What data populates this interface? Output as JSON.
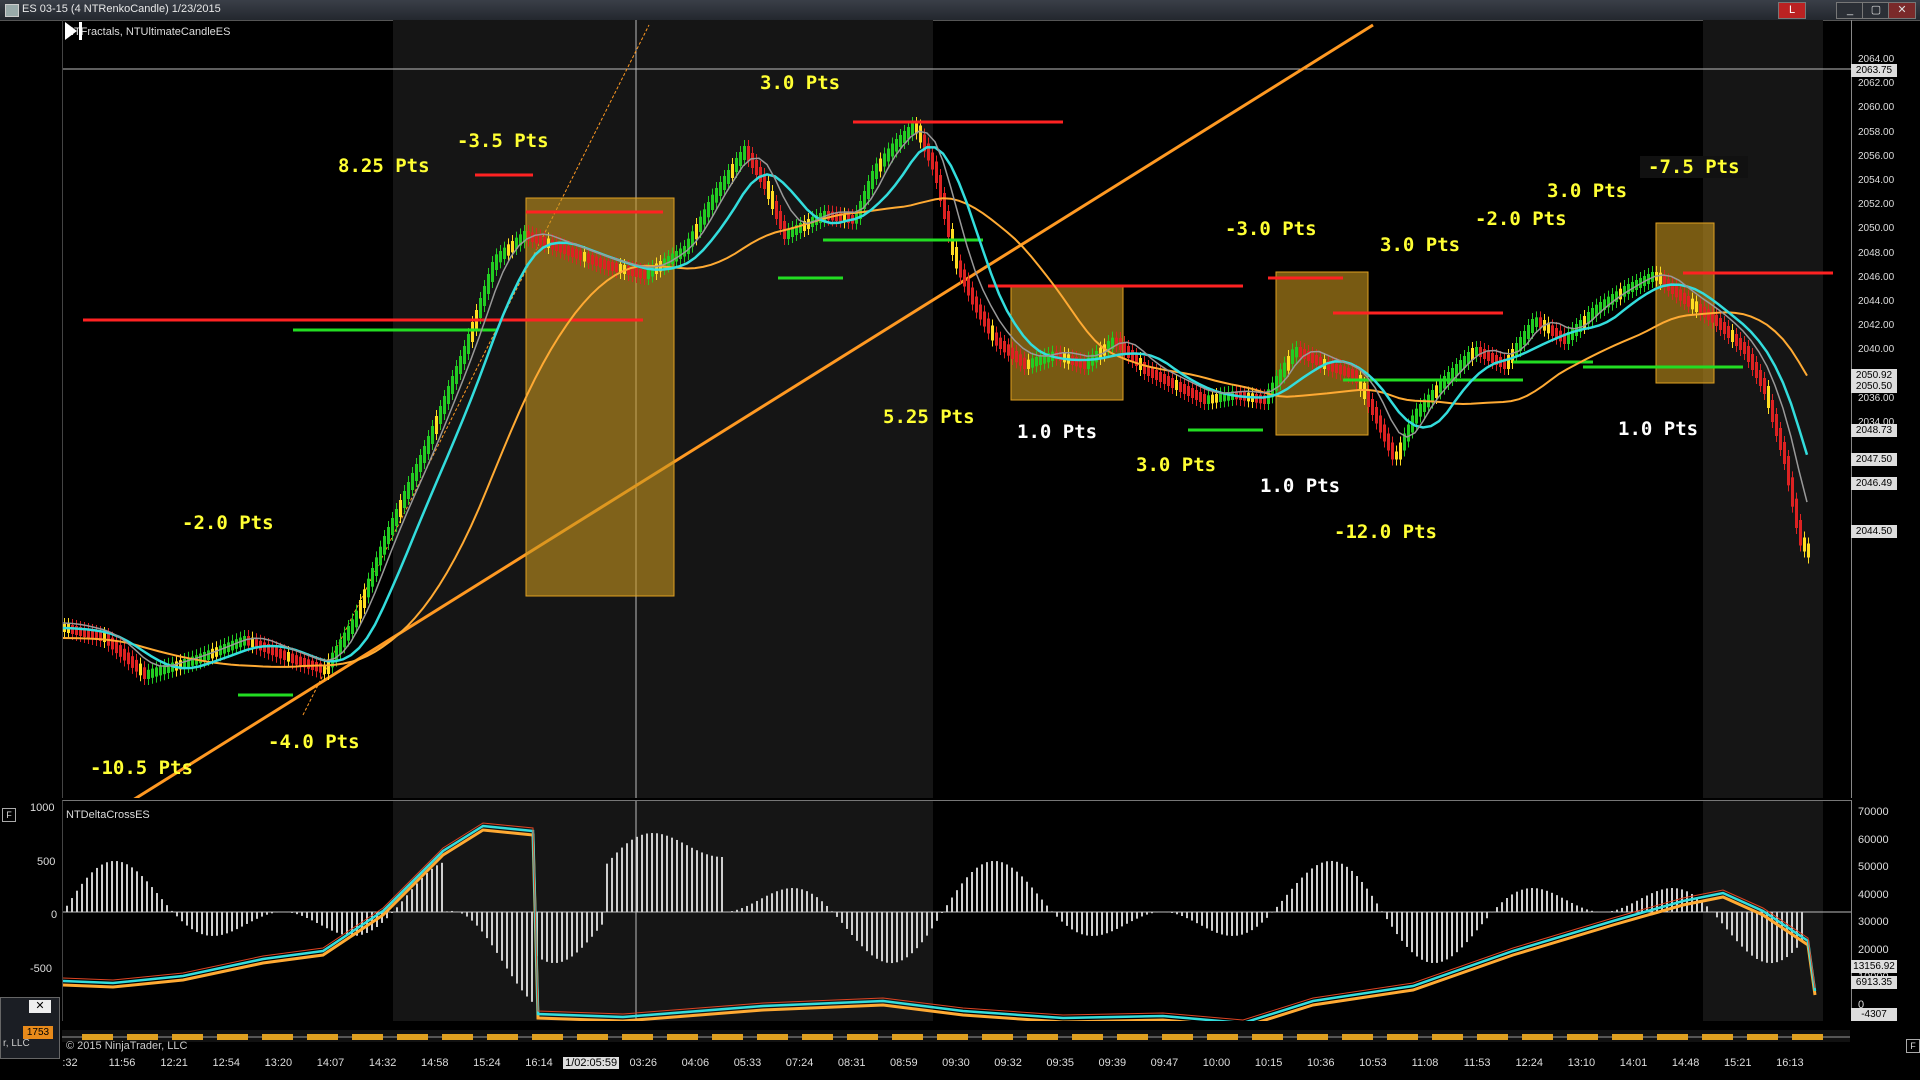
{
  "window": {
    "title": "ES 03-15 (4 NTRenkoCandle)  1/23/2015",
    "minimize_label": "_",
    "restore_label": "▢",
    "close_label": "✕",
    "alert_label": "L"
  },
  "price_panel": {
    "indicators_label": "NTFractals, NTUltimateCandleES",
    "y_axis_ticks": [
      "2064.00",
      "2062.00",
      "2060.00",
      "2058.00",
      "2056.00",
      "2054.00",
      "2052.00",
      "2050.00",
      "2048.00",
      "2046.00",
      "2044.00",
      "2042.00",
      "2040.00",
      "2038.00",
      "2036.00",
      "2034.00"
    ],
    "price_markers": [
      "2063.75",
      "2050.92",
      "2050.50",
      "2048.73",
      "2047.50",
      "2046.49",
      "2044.50"
    ],
    "trade_results": [
      {
        "text": "-10.5 Pts",
        "color": "#ffff33"
      },
      {
        "text": "-4.0 Pts",
        "color": "#ffff33"
      },
      {
        "text": "-2.0 Pts",
        "color": "#ffff33"
      },
      {
        "text": "8.25 Pts",
        "color": "#ffff33"
      },
      {
        "text": "-3.5 Pts",
        "color": "#ffff33"
      },
      {
        "text": "3.0 Pts",
        "color": "#ffff33"
      },
      {
        "text": "5.25 Pts",
        "color": "#ffff33"
      },
      {
        "text": "1.0 Pts",
        "color": "#ffffff"
      },
      {
        "text": "3.0 Pts",
        "color": "#ffff33"
      },
      {
        "text": "-3.0 Pts",
        "color": "#ffff33"
      },
      {
        "text": "1.0 Pts",
        "color": "#ffffff"
      },
      {
        "text": "-12.0 Pts",
        "color": "#ffff33"
      },
      {
        "text": "3.0 Pts",
        "color": "#ffff33"
      },
      {
        "text": "-2.0 Pts",
        "color": "#ffff33"
      },
      {
        "text": "3.0 Pts",
        "color": "#ffff33"
      },
      {
        "text": "-7.5 Pts",
        "color": "#ffff33"
      },
      {
        "text": "1.0 Pts",
        "color": "#ffffff"
      }
    ]
  },
  "osc_panel": {
    "indicator_label": "NTDeltaCrossES",
    "left_ticks": [
      "1000",
      "500",
      "0",
      "-500"
    ],
    "right_ticks": [
      "70000",
      "60000",
      "50000",
      "40000",
      "30000",
      "20000",
      "10000",
      "0"
    ],
    "price_markers": [
      "13156.92",
      "6913.35",
      "-4307"
    ]
  },
  "time_axis": {
    "labels": [
      ":32",
      "11:56",
      "12:21",
      "12:54",
      "13:20",
      "14:07",
      "14:32",
      "14:58",
      "15:24",
      "16:14",
      "1/02:05:59",
      "03:26",
      "04:06",
      "05:33",
      "07:24",
      "08:31",
      "08:59",
      "09:30",
      "09:32",
      "09:35",
      "09:39",
      "09:47",
      "10:00",
      "10:15",
      "10:36",
      "10:53",
      "11:08",
      "11:53",
      "12:24",
      "13:10",
      "14:01",
      "14:48",
      "15:21",
      "16:13"
    ]
  },
  "footer": {
    "copyright": "© 2015 NinjaTrader, LLC",
    "mini_window_text": "r, LLC",
    "mini_badge": "1753",
    "mini_close": "✕",
    "f_box": "F"
  },
  "colors": {
    "background": "#000000",
    "bull_candle": "#22cc22",
    "bear_candle": "#dd2222",
    "box_fill": "#c8961e",
    "trendline": "#ff9922",
    "ema_cyan": "#33dddd",
    "ema_orange": "#ffaa33"
  }
}
